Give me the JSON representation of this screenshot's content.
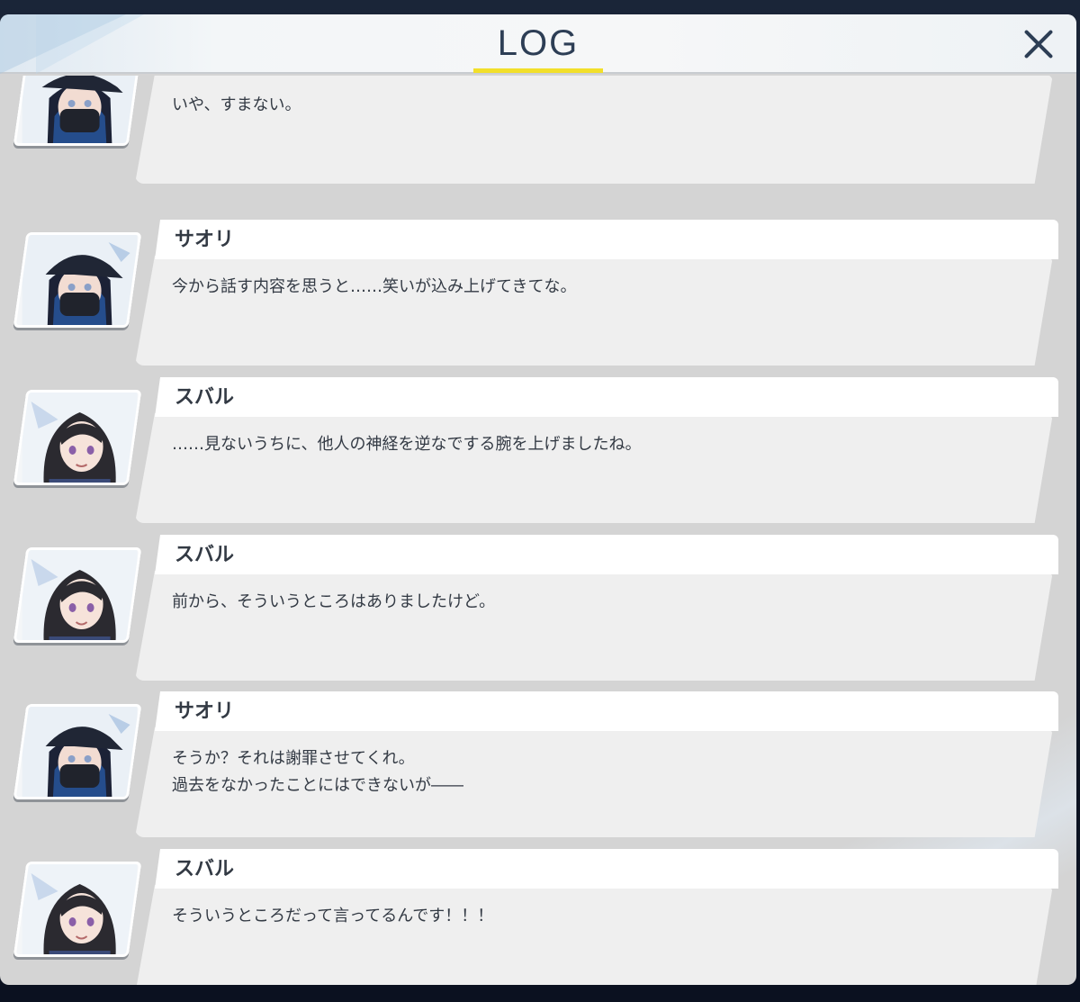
{
  "header": {
    "title": "LOG",
    "close_icon": "close-icon"
  },
  "colors": {
    "accent_underline": "#f2df2a",
    "title_text": "#2d3e55",
    "bubble_bg": "#efefef",
    "name_plate_bg": "#ffffff",
    "panel_bg": "#d4d4d4"
  },
  "entries": [
    {
      "speaker": "",
      "avatar": "saori-avatar",
      "text": "いや、すまない。"
    },
    {
      "speaker": "サオリ",
      "avatar": "saori-avatar",
      "text": "今から話す内容を思うと……笑いが込み上げてきてな。"
    },
    {
      "speaker": "スバル",
      "avatar": "subaru-avatar",
      "text": "……見ないうちに、他人の神経を逆なでする腕を上げましたね。"
    },
    {
      "speaker": "スバル",
      "avatar": "subaru-avatar",
      "text": "前から、そういうところはありましたけど。"
    },
    {
      "speaker": "サオリ",
      "avatar": "saori-avatar",
      "text": "そうか？それは謝罪させてくれ。\n過去をなかったことにはできないが――"
    },
    {
      "speaker": "スバル",
      "avatar": "subaru-avatar",
      "text": "そういうところだって言ってるんです！！！"
    }
  ]
}
